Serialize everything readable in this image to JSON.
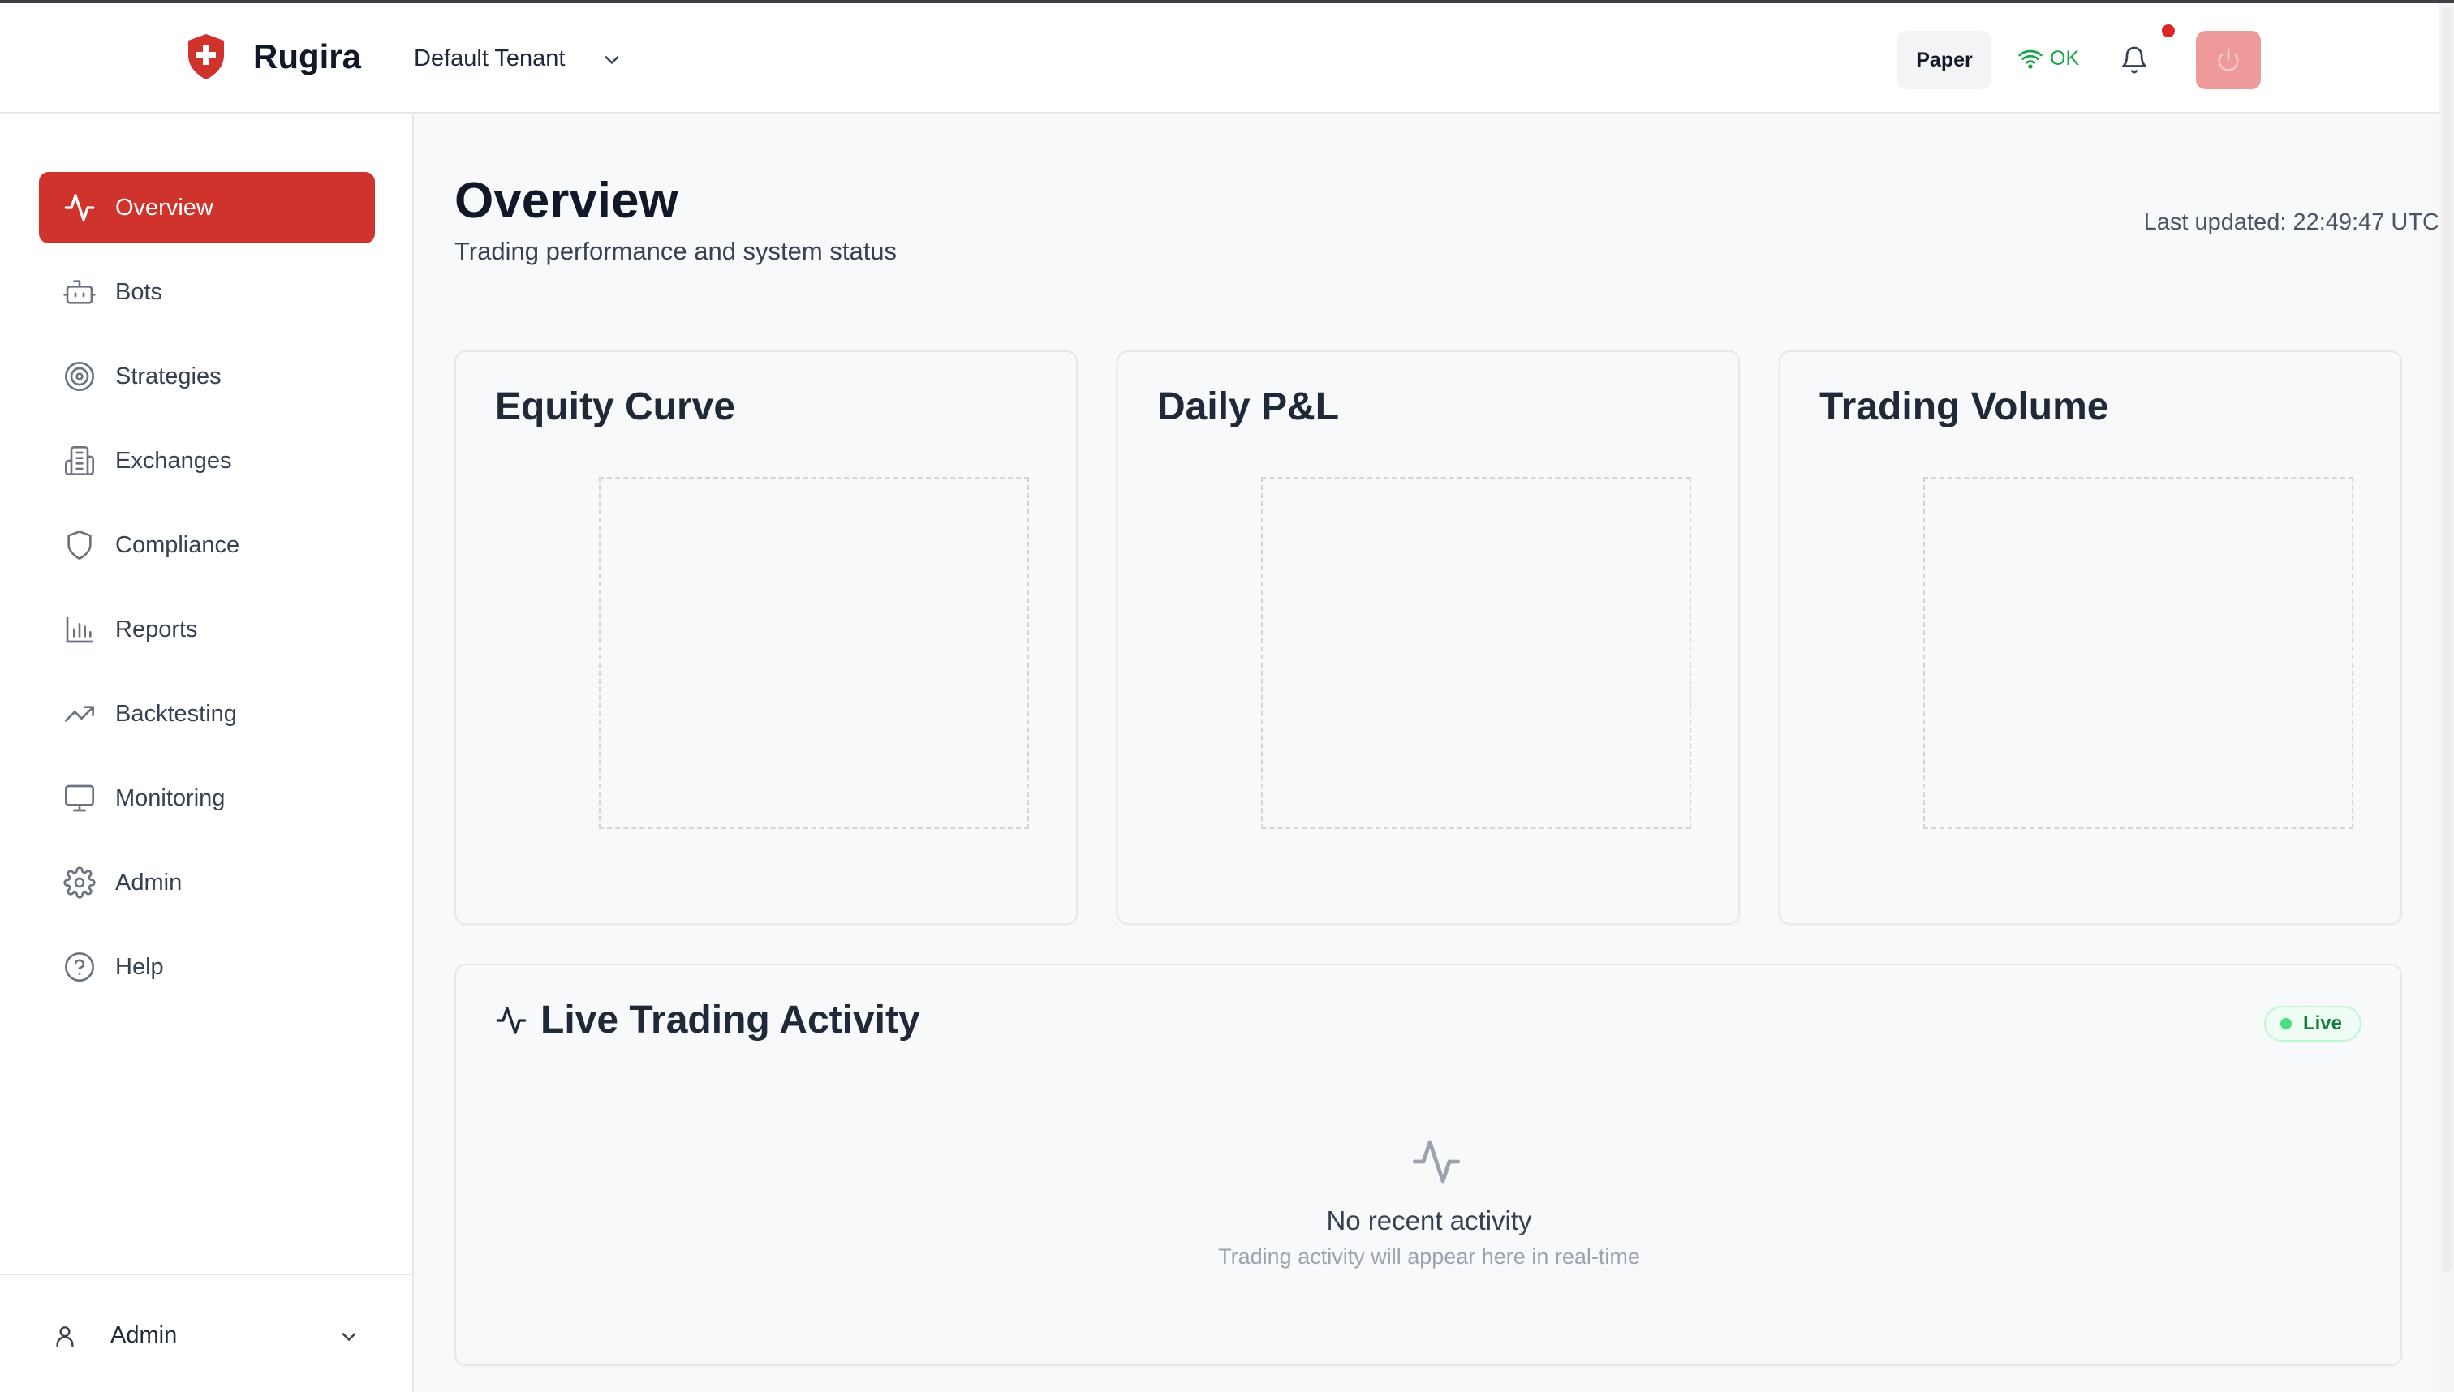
{
  "header": {
    "brand": "Rugira",
    "tenant": "Default Tenant",
    "mode_label": "Paper",
    "connection_status": "OK",
    "icons": {
      "logo": "shield-cross-icon",
      "tenant_dropdown": "chevron-down-icon",
      "connection": "wifi-icon",
      "notifications": "bell-icon",
      "power": "power-icon"
    },
    "colors": {
      "brand_red": "#d0322c",
      "status_ok": "#16a34a",
      "notification_dot": "#dc2626",
      "power_button": "#ee9a9a"
    }
  },
  "sidebar": {
    "items": [
      {
        "label": "Overview",
        "icon": "activity-icon",
        "active": true
      },
      {
        "label": "Bots",
        "icon": "bot-icon",
        "active": false
      },
      {
        "label": "Strategies",
        "icon": "target-icon",
        "active": false
      },
      {
        "label": "Exchanges",
        "icon": "building-icon",
        "active": false
      },
      {
        "label": "Compliance",
        "icon": "shield-icon",
        "active": false
      },
      {
        "label": "Reports",
        "icon": "bar-chart-icon",
        "active": false
      },
      {
        "label": "Backtesting",
        "icon": "trending-up-icon",
        "active": false
      },
      {
        "label": "Monitoring",
        "icon": "monitor-icon",
        "active": false
      },
      {
        "label": "Admin",
        "icon": "gear-icon",
        "active": false
      },
      {
        "label": "Help",
        "icon": "help-circle-icon",
        "active": false
      }
    ],
    "footer": {
      "user_label": "Admin",
      "icon": "user-icon",
      "chevron": "chevron-down-icon"
    }
  },
  "main": {
    "title": "Overview",
    "subtitle": "Trading performance and system status",
    "last_updated": "Last updated: 22:49:47 UTC",
    "cards": [
      {
        "title": "Equity Curve"
      },
      {
        "title": "Daily P&L"
      },
      {
        "title": "Trading Volume"
      }
    ],
    "activity": {
      "title": "Live Trading Activity",
      "badge": "Live",
      "empty_title": "No recent activity",
      "empty_subtitle": "Trading activity will appear here in real-time",
      "icon": "activity-icon"
    }
  }
}
